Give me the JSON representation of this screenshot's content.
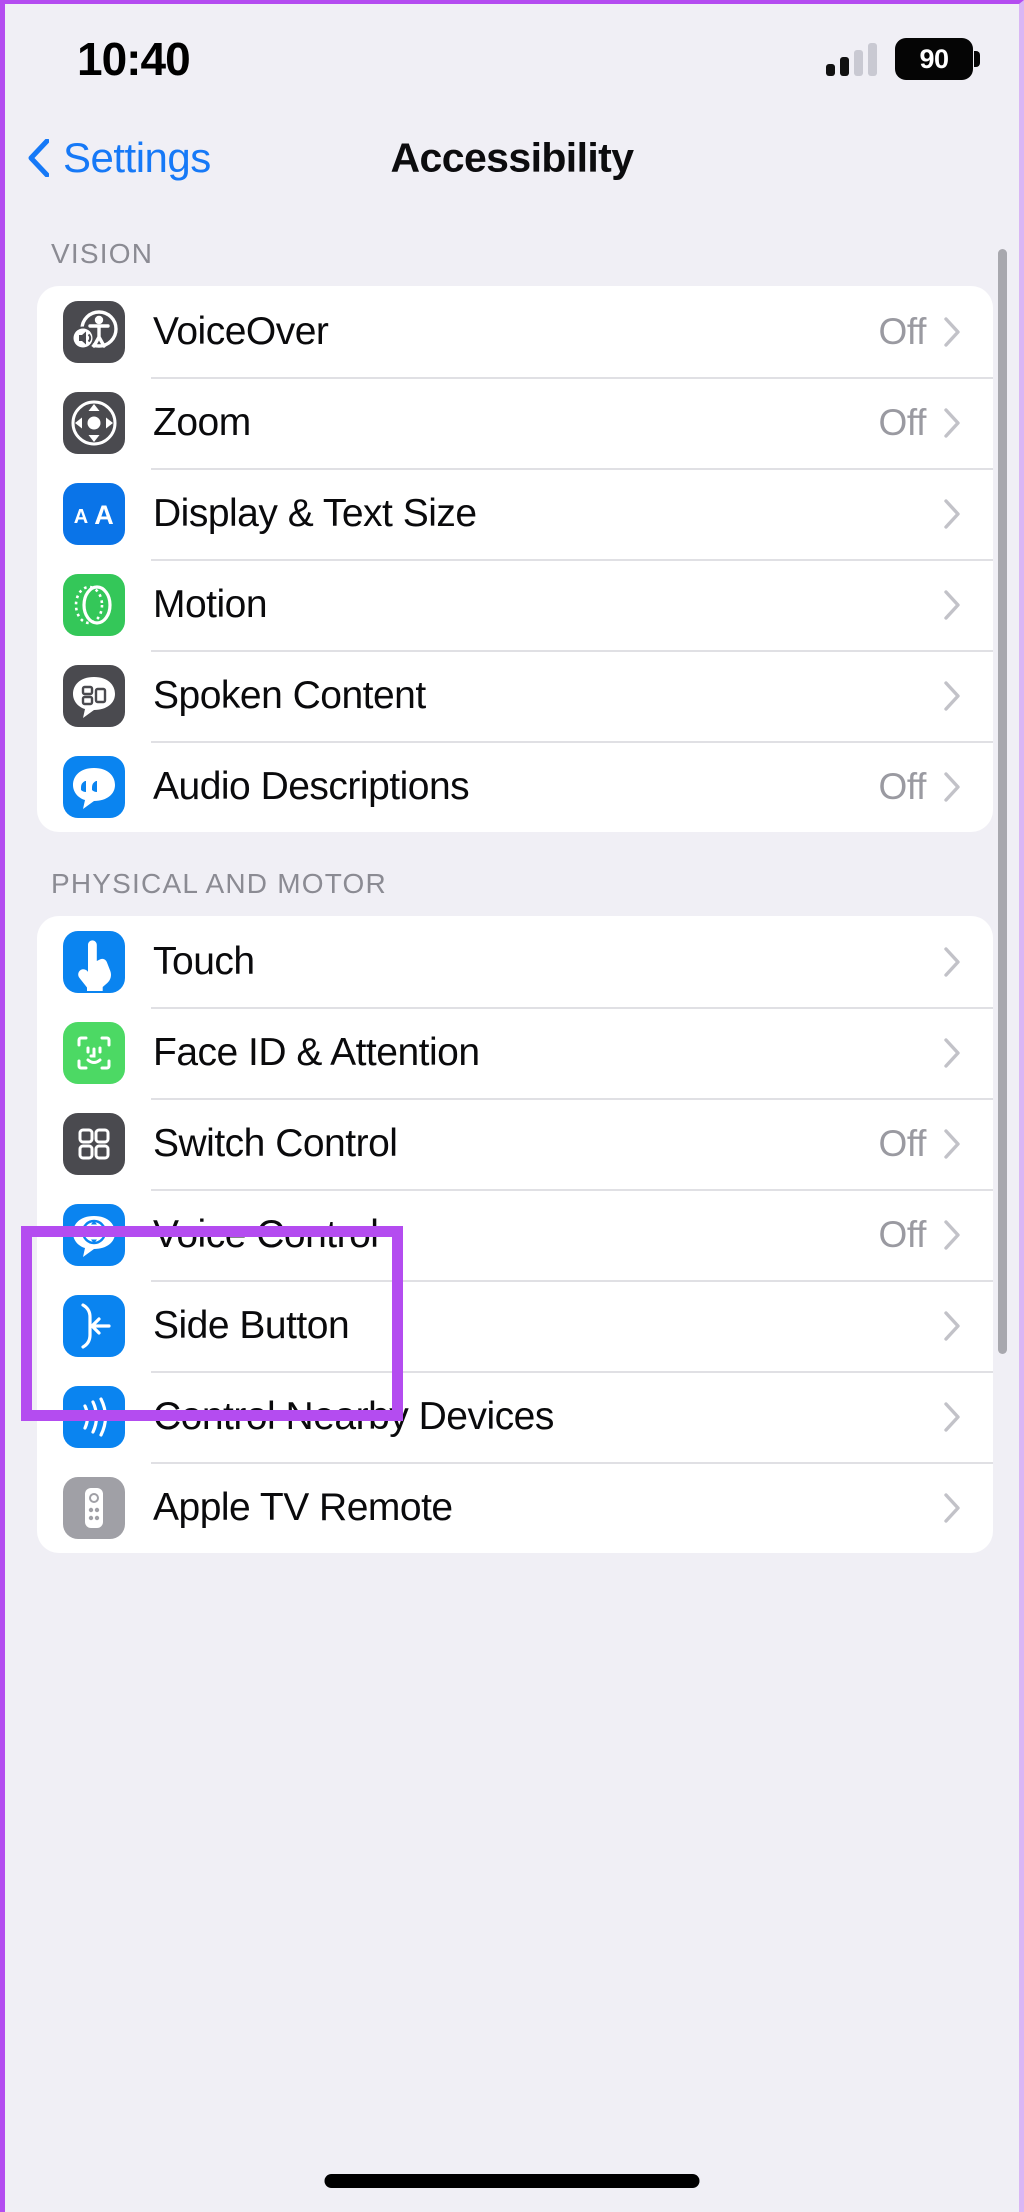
{
  "status_bar": {
    "time": "10:40",
    "signal_icon": "cellular-signal-icon",
    "signal_bars_filled": 2,
    "signal_bars_total": 4,
    "battery_level": "90",
    "battery_icon": "battery-icon"
  },
  "nav": {
    "back_label": "Settings",
    "back_icon": "chevron-left-icon",
    "title": "Accessibility",
    "accent_color": "#1679f7"
  },
  "highlight": {
    "color": "#b44cf0",
    "target": "physical-and-motor-touch"
  },
  "sections": [
    {
      "header": "VISION",
      "rows": [
        {
          "label": "VoiceOver",
          "value": "Off",
          "icon": "voiceover-icon",
          "icon_color": "#4a4a4f"
        },
        {
          "label": "Zoom",
          "value": "Off",
          "icon": "zoom-icon",
          "icon_color": "#4a4a4f"
        },
        {
          "label": "Display & Text Size",
          "value": "",
          "icon": "display-text-size-icon",
          "icon_color": "#0a74e8"
        },
        {
          "label": "Motion",
          "value": "",
          "icon": "motion-icon",
          "icon_color": "#34c759"
        },
        {
          "label": "Spoken Content",
          "value": "",
          "icon": "spoken-content-icon",
          "icon_color": "#4a4a4f"
        },
        {
          "label": "Audio Descriptions",
          "value": "Off",
          "icon": "audio-descriptions-icon",
          "icon_color": "#0a84f0"
        }
      ]
    },
    {
      "header": "PHYSICAL AND MOTOR",
      "rows": [
        {
          "label": "Touch",
          "value": "",
          "icon": "touch-icon",
          "icon_color": "#0a84f0"
        },
        {
          "label": "Face ID & Attention",
          "value": "",
          "icon": "face-id-icon",
          "icon_color": "#4cd964"
        },
        {
          "label": "Switch Control",
          "value": "Off",
          "icon": "switch-control-icon",
          "icon_color": "#4a4a4f"
        },
        {
          "label": "Voice Control",
          "value": "Off",
          "icon": "voice-control-icon",
          "icon_color": "#0a84f0"
        },
        {
          "label": "Side Button",
          "value": "",
          "icon": "side-button-icon",
          "icon_color": "#0a84f0"
        },
        {
          "label": "Control Nearby Devices",
          "value": "",
          "icon": "control-nearby-devices-icon",
          "icon_color": "#0a84f0"
        },
        {
          "label": "Apple TV Remote",
          "value": "",
          "icon": "apple-tv-remote-icon",
          "icon_color": "#a0a0a6"
        }
      ]
    }
  ]
}
